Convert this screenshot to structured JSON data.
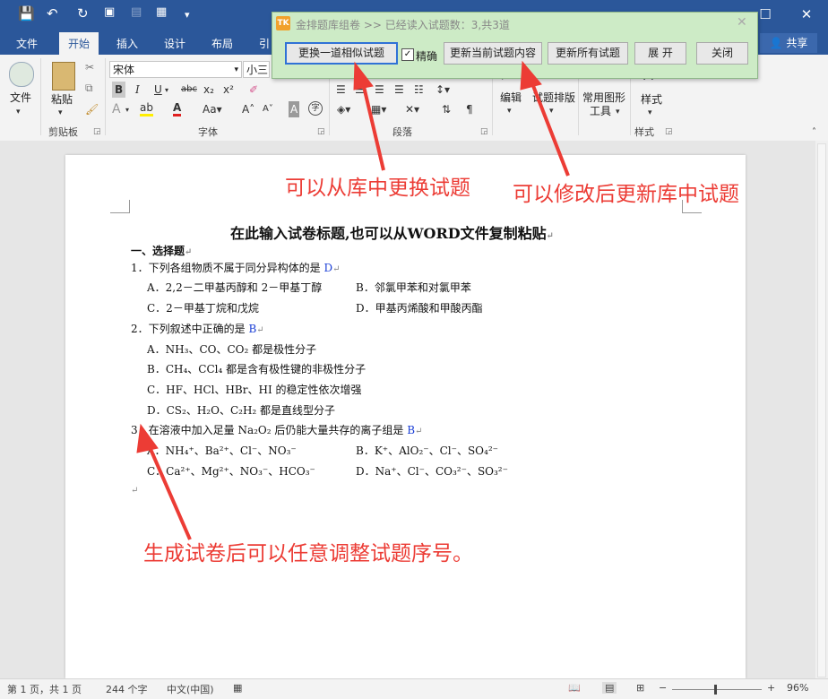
{
  "titlebar": {
    "doc_title": "...",
    "minimize": "—",
    "maximize": "☐",
    "close": "✕"
  },
  "tabs": [
    "文件",
    "开始",
    "插入",
    "设计",
    "布局",
    "引"
  ],
  "share_label": "共享",
  "ribbon": {
    "clipboard": {
      "paste": "粘贴",
      "group": "剪贴板",
      "file_button": "文件"
    },
    "font": {
      "name": "宋体",
      "size": "小三",
      "group": "字体"
    },
    "paragraph": {
      "group": "段落"
    },
    "edit": "编辑",
    "exam_layout": "试题排版",
    "common_shapes_1": "常用图形",
    "common_shapes_2": "工具",
    "styles_button": "样式",
    "styles_group": "样式"
  },
  "dialog": {
    "title": "金排题库组卷 >> 已经读入试题数：3,共3道",
    "tk": "TK",
    "close": "✕",
    "btn_replace": "更换一道相似试题",
    "exact_label": "精确",
    "exact_checked": true,
    "btn_update_current": "更新当前试题内容",
    "btn_update_all": "更新所有试题",
    "btn_expand": "展 开",
    "btn_close": "关闭"
  },
  "document": {
    "title": "在此输入试卷标题,也可以从WORD文件复制粘贴",
    "section": "一、选择题",
    "q1": {
      "stem": "1．下列各组物质不属于同分异构体的是",
      "answer": "D",
      "a": "A．2,2－二甲基丙醇和 2－甲基丁醇",
      "b": "B．邻氯甲苯和对氯甲苯",
      "c": "C．2－甲基丁烷和戊烷",
      "d": "D．甲基丙烯酸和甲酸丙酯"
    },
    "q2": {
      "stem": "2．下列叙述中正确的是",
      "answer": "B",
      "a": "A．NH₃、CO、CO₂ 都是极性分子",
      "b": "B．CH₄、CCl₄ 都是含有极性键的非极性分子",
      "c": "C．HF、HCl、HBr、HI 的稳定性依次增强",
      "d": "D．CS₂、H₂O、C₂H₂ 都是直线型分子"
    },
    "q3": {
      "stem": "3．在溶液中加入足量 Na₂O₂ 后仍能大量共存的离子组是",
      "answer": "B",
      "a": "A．NH₄⁺、Ba²⁺、Cl⁻、NO₃⁻",
      "b": "B．K⁺、AlO₂⁻、Cl⁻、SO₄²⁻",
      "c": "C．Ca²⁺、Mg²⁺、NO₃⁻、HCO₃⁻",
      "d": "D．Na⁺、Cl⁻、CO₃²⁻、SO₃²⁻"
    },
    "para_mark": "↵"
  },
  "annotations": {
    "replace": "可以从库中更换试题",
    "update": "可以修改后更新库中试题",
    "reorder": "生成试卷后可以任意调整试题序号。"
  },
  "status": {
    "page": "第 1 页，共 1 页",
    "words": "244 个字",
    "lang": "中文(中国)",
    "zoom": "96%"
  },
  "colors": {
    "accent": "#2b579a",
    "annotation": "#ec3c35",
    "dialog_bg": "#cdebc6",
    "answer": "#1a3ed6"
  }
}
